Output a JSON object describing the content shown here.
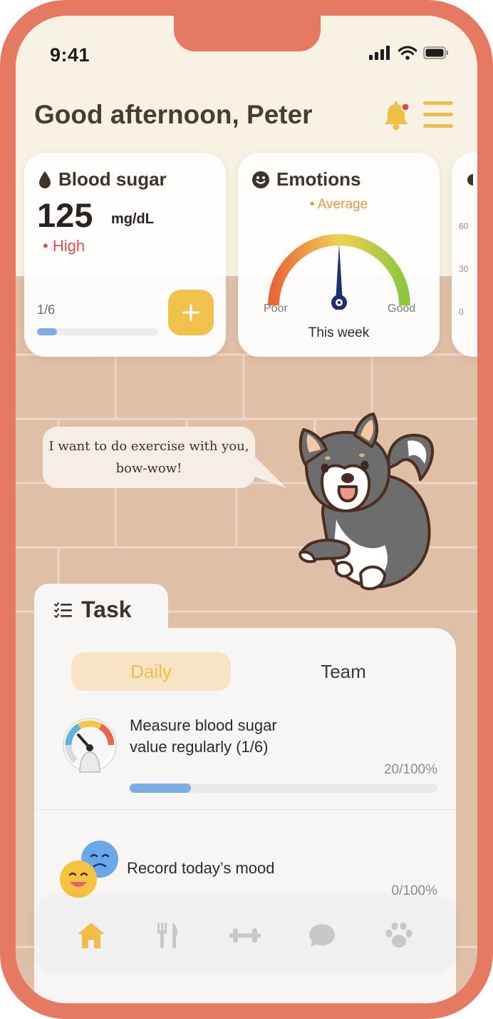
{
  "status_bar": {
    "time": "9:41"
  },
  "header": {
    "greeting": "Good afternoon, Peter"
  },
  "blood_sugar_card": {
    "title": "Blood sugar",
    "value": "125",
    "unit": "mg/dL",
    "status": "• High",
    "progress_label": "1/6",
    "progress_fraction": 0.167,
    "add_button": "+"
  },
  "emotions_card": {
    "title": "Emotions",
    "average_label": "• Average",
    "poor_label": "Poor",
    "good_label": "Good",
    "period_label": "This week"
  },
  "third_card": {
    "ticks": [
      "60",
      "30",
      "0"
    ]
  },
  "pet": {
    "speech": "I want to do exercise with you, bow-wow!"
  },
  "task_section": {
    "title": "Task",
    "tabs": {
      "daily": "Daily",
      "team": "Team"
    },
    "items": [
      {
        "title_line1": "Measure blood sugar",
        "title_line2": "value regularly (1/6)",
        "percent_text": "20/100%",
        "progress_fraction": 0.2
      },
      {
        "title": "Record today’s mood",
        "percent_text": "0/100%",
        "progress_fraction": 0
      }
    ]
  },
  "tab_bar": {
    "items": [
      {
        "icon": "home-icon",
        "active": true
      },
      {
        "icon": "fork-knife-icon",
        "active": false
      },
      {
        "icon": "dumbbell-icon",
        "active": false
      },
      {
        "icon": "chat-bubble-icon",
        "active": false
      },
      {
        "icon": "paw-icon",
        "active": false
      }
    ]
  },
  "colors": {
    "frame": "#e57962",
    "accent_yellow": "#f1bd49",
    "high_red": "#d9514e",
    "average_orange": "#eb9436",
    "progress_blue": "#7eace4",
    "brick": "#dfbfa6"
  }
}
